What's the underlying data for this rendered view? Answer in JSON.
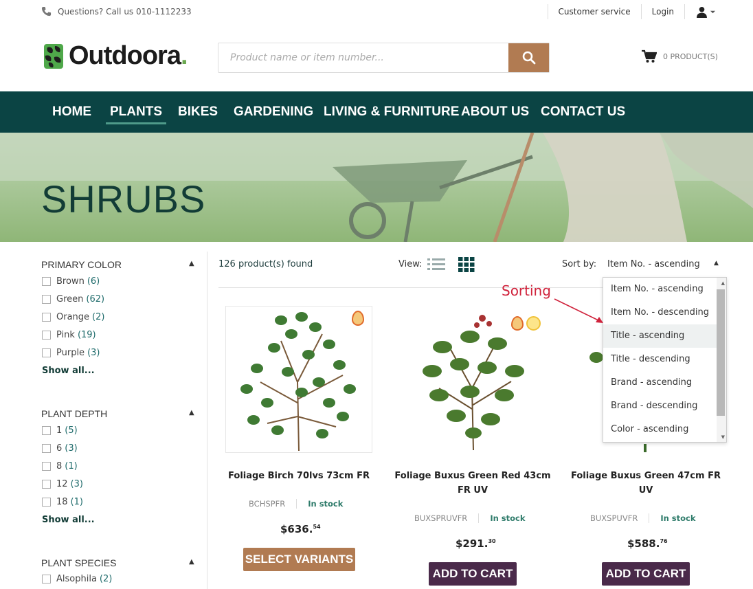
{
  "topbar": {
    "phone": "Questions? Call us 010-1112233",
    "customer_service": "Customer service",
    "login": "Login"
  },
  "header": {
    "logo_text": "Outdoora",
    "search_placeholder": "Product name or item number...",
    "cart_label": "0 PRODUCT(S)"
  },
  "nav": [
    "HOME",
    "PLANTS",
    "BIKES",
    "GARDENING",
    "LIVING & FURNITURE",
    "ABOUT US",
    "CONTACT US"
  ],
  "nav_active": "PLANTS",
  "hero": {
    "title": "SHRUBS"
  },
  "filters": [
    {
      "title": "PRIMARY COLOR",
      "options": [
        {
          "label": "Brown",
          "count": "(6)"
        },
        {
          "label": "Green",
          "count": "(62)"
        },
        {
          "label": "Orange",
          "count": "(2)"
        },
        {
          "label": "Pink",
          "count": "(19)"
        },
        {
          "label": "Purple",
          "count": "(3)"
        }
      ],
      "show_all": "Show all..."
    },
    {
      "title": "PLANT DEPTH",
      "options": [
        {
          "label": "1",
          "count": "(5)"
        },
        {
          "label": "6",
          "count": "(3)"
        },
        {
          "label": "8",
          "count": "(1)"
        },
        {
          "label": "12",
          "count": "(3)"
        },
        {
          "label": "18",
          "count": "(1)"
        }
      ],
      "show_all": "Show all..."
    },
    {
      "title": "PLANT SPECIES",
      "options": [
        {
          "label": "Alsophila",
          "count": "(2)"
        }
      ]
    }
  ],
  "results": {
    "found": "126 product(s) found",
    "view_label": "View:",
    "sort_label": "Sort by:",
    "sort_value": "Item No. - ascending"
  },
  "sort_options": [
    "Item No. - ascending",
    "Item No. - descending",
    "Title - ascending",
    "Title - descending",
    "Brand - ascending",
    "Brand - descending",
    "Color - ascending"
  ],
  "sort_highlighted": "Title - ascending",
  "products": [
    {
      "title": "Foliage Birch 70lvs 73cm FR",
      "sku": "BCHSPFR",
      "stock": "In stock",
      "price_main": "$636.",
      "price_cents": "54",
      "button": "SELECT VARIANTS"
    },
    {
      "title": "Foliage Buxus Green Red 43cm FR UV",
      "sku": "BUXSPRUVFR",
      "stock": "In stock",
      "price_main": "$291.",
      "price_cents": "30",
      "button": "ADD TO CART"
    },
    {
      "title": "Foliage Buxus Green 47cm FR UV",
      "sku": "BUXSPUVFR",
      "stock": "In stock",
      "price_main": "$588.",
      "price_cents": "76",
      "button": "ADD TO CART"
    }
  ],
  "annotation": "Sorting",
  "colors": {
    "nav_bg": "#0b4444",
    "accent_brown": "#b17b52",
    "cart_purple": "#4a2a4a",
    "stock_green": "#2e7b6a",
    "annotation_red": "#d0233c"
  }
}
